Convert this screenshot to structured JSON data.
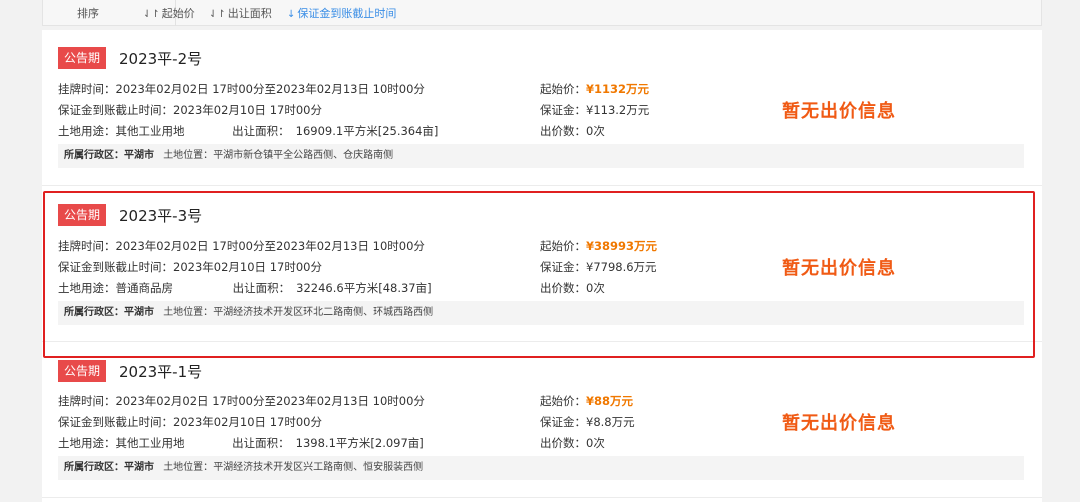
{
  "sort": {
    "label": "排序",
    "options": [
      {
        "arrow": "⇃↾",
        "text": "起始价"
      },
      {
        "arrow": "⇃↾",
        "text": "出让面积"
      },
      {
        "arrow": "↓",
        "text": "保证金到账截止时间"
      }
    ]
  },
  "listings": [
    {
      "badge": "公告期",
      "title": "2023平-2号",
      "listing_time_label": "挂牌时间：",
      "listing_time": "2023年02月02日 17时00分至2023年02月13日 10时00分",
      "deposit_deadline_label": "保证金到账截止时间：",
      "deposit_deadline": "2023年02月10日 17时00分",
      "land_use_label": "土地用途：",
      "land_use": "其他工业用地",
      "area_label": "出让面积：",
      "area": "16909.1平方米[25.364亩]",
      "start_price_label": "起始价：",
      "start_price": "¥1132万元",
      "deposit_label": "保证金：",
      "deposit": "¥113.2万元",
      "bid_count_label": "出价数：",
      "bid_count": "0次",
      "bid_status": "暂无出价信息",
      "district_label": "所属行政区：",
      "district": "平湖市",
      "location_label": "土地位置：",
      "location": "平湖市新仓镇平全公路西侧、仓庆路南侧"
    },
    {
      "badge": "公告期",
      "title": "2023平-3号",
      "listing_time_label": "挂牌时间：",
      "listing_time": "2023年02月02日 17时00分至2023年02月13日 10时00分",
      "deposit_deadline_label": "保证金到账截止时间：",
      "deposit_deadline": "2023年02月10日 17时00分",
      "land_use_label": "土地用途：",
      "land_use": "普通商品房",
      "area_label": "出让面积：",
      "area": "32246.6平方米[48.37亩]",
      "start_price_label": "起始价：",
      "start_price": "¥38993万元",
      "deposit_label": "保证金：",
      "deposit": "¥7798.6万元",
      "bid_count_label": "出价数：",
      "bid_count": "0次",
      "bid_status": "暂无出价信息",
      "district_label": "所属行政区：",
      "district": "平湖市",
      "location_label": "土地位置：",
      "location": "平湖经济技术开发区环北二路南侧、环城西路西侧"
    },
    {
      "badge": "公告期",
      "title": "2023平-1号",
      "listing_time_label": "挂牌时间：",
      "listing_time": "2023年02月02日 17时00分至2023年02月13日 10时00分",
      "deposit_deadline_label": "保证金到账截止时间：",
      "deposit_deadline": "2023年02月10日 17时00分",
      "land_use_label": "土地用途：",
      "land_use": "其他工业用地",
      "area_label": "出让面积：",
      "area": "1398.1平方米[2.097亩]",
      "start_price_label": "起始价：",
      "start_price": "¥88万元",
      "deposit_label": "保证金：",
      "deposit": "¥8.8万元",
      "bid_count_label": "出价数：",
      "bid_count": "0次",
      "bid_status": "暂无出价信息",
      "district_label": "所属行政区：",
      "district": "平湖市",
      "location_label": "土地位置：",
      "location": "平湖经济技术开发区兴工路南侧、恒安服装西侧"
    }
  ],
  "colors": {
    "badge_bg": "#e84a4a",
    "price_highlight": "#f07800",
    "bid_status": "#f05a14",
    "selection_border": "#e02020",
    "active_sort": "#3a8ee6"
  }
}
